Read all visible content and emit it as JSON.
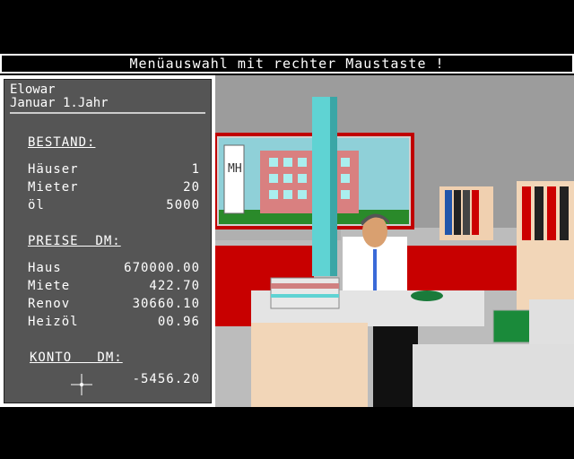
{
  "status_bar": {
    "text": "Menüauswahl mit rechter Maustaste !"
  },
  "player": {
    "name": "Elowar",
    "date": "Januar 1.Jahr"
  },
  "bestand": {
    "heading": "BESTAND:",
    "rows": [
      {
        "label": "Häuser",
        "value": "1"
      },
      {
        "label": "Mieter",
        "value": "20"
      },
      {
        "label": "öl",
        "value": "5000"
      }
    ]
  },
  "preise": {
    "heading": "PREISE  DM:",
    "rows": [
      {
        "label": "Haus",
        "value": "670000.00"
      },
      {
        "label": "Miete",
        "value": "422.70"
      },
      {
        "label": "Renov",
        "value": "30660.10"
      },
      {
        "label": "Heizöl",
        "value": "00.96"
      }
    ]
  },
  "konto": {
    "heading": "KONTO   DM:",
    "value": "-5456.20"
  },
  "scene": {
    "poster_sign": "MH"
  },
  "colors": {
    "wall": "#9a9a9a",
    "desk": "#d8d8d8",
    "shelf": "#f0d0b0",
    "floor": "#c8c8c8",
    "red": "#cc0000",
    "cyan": "#5fd3d3"
  }
}
